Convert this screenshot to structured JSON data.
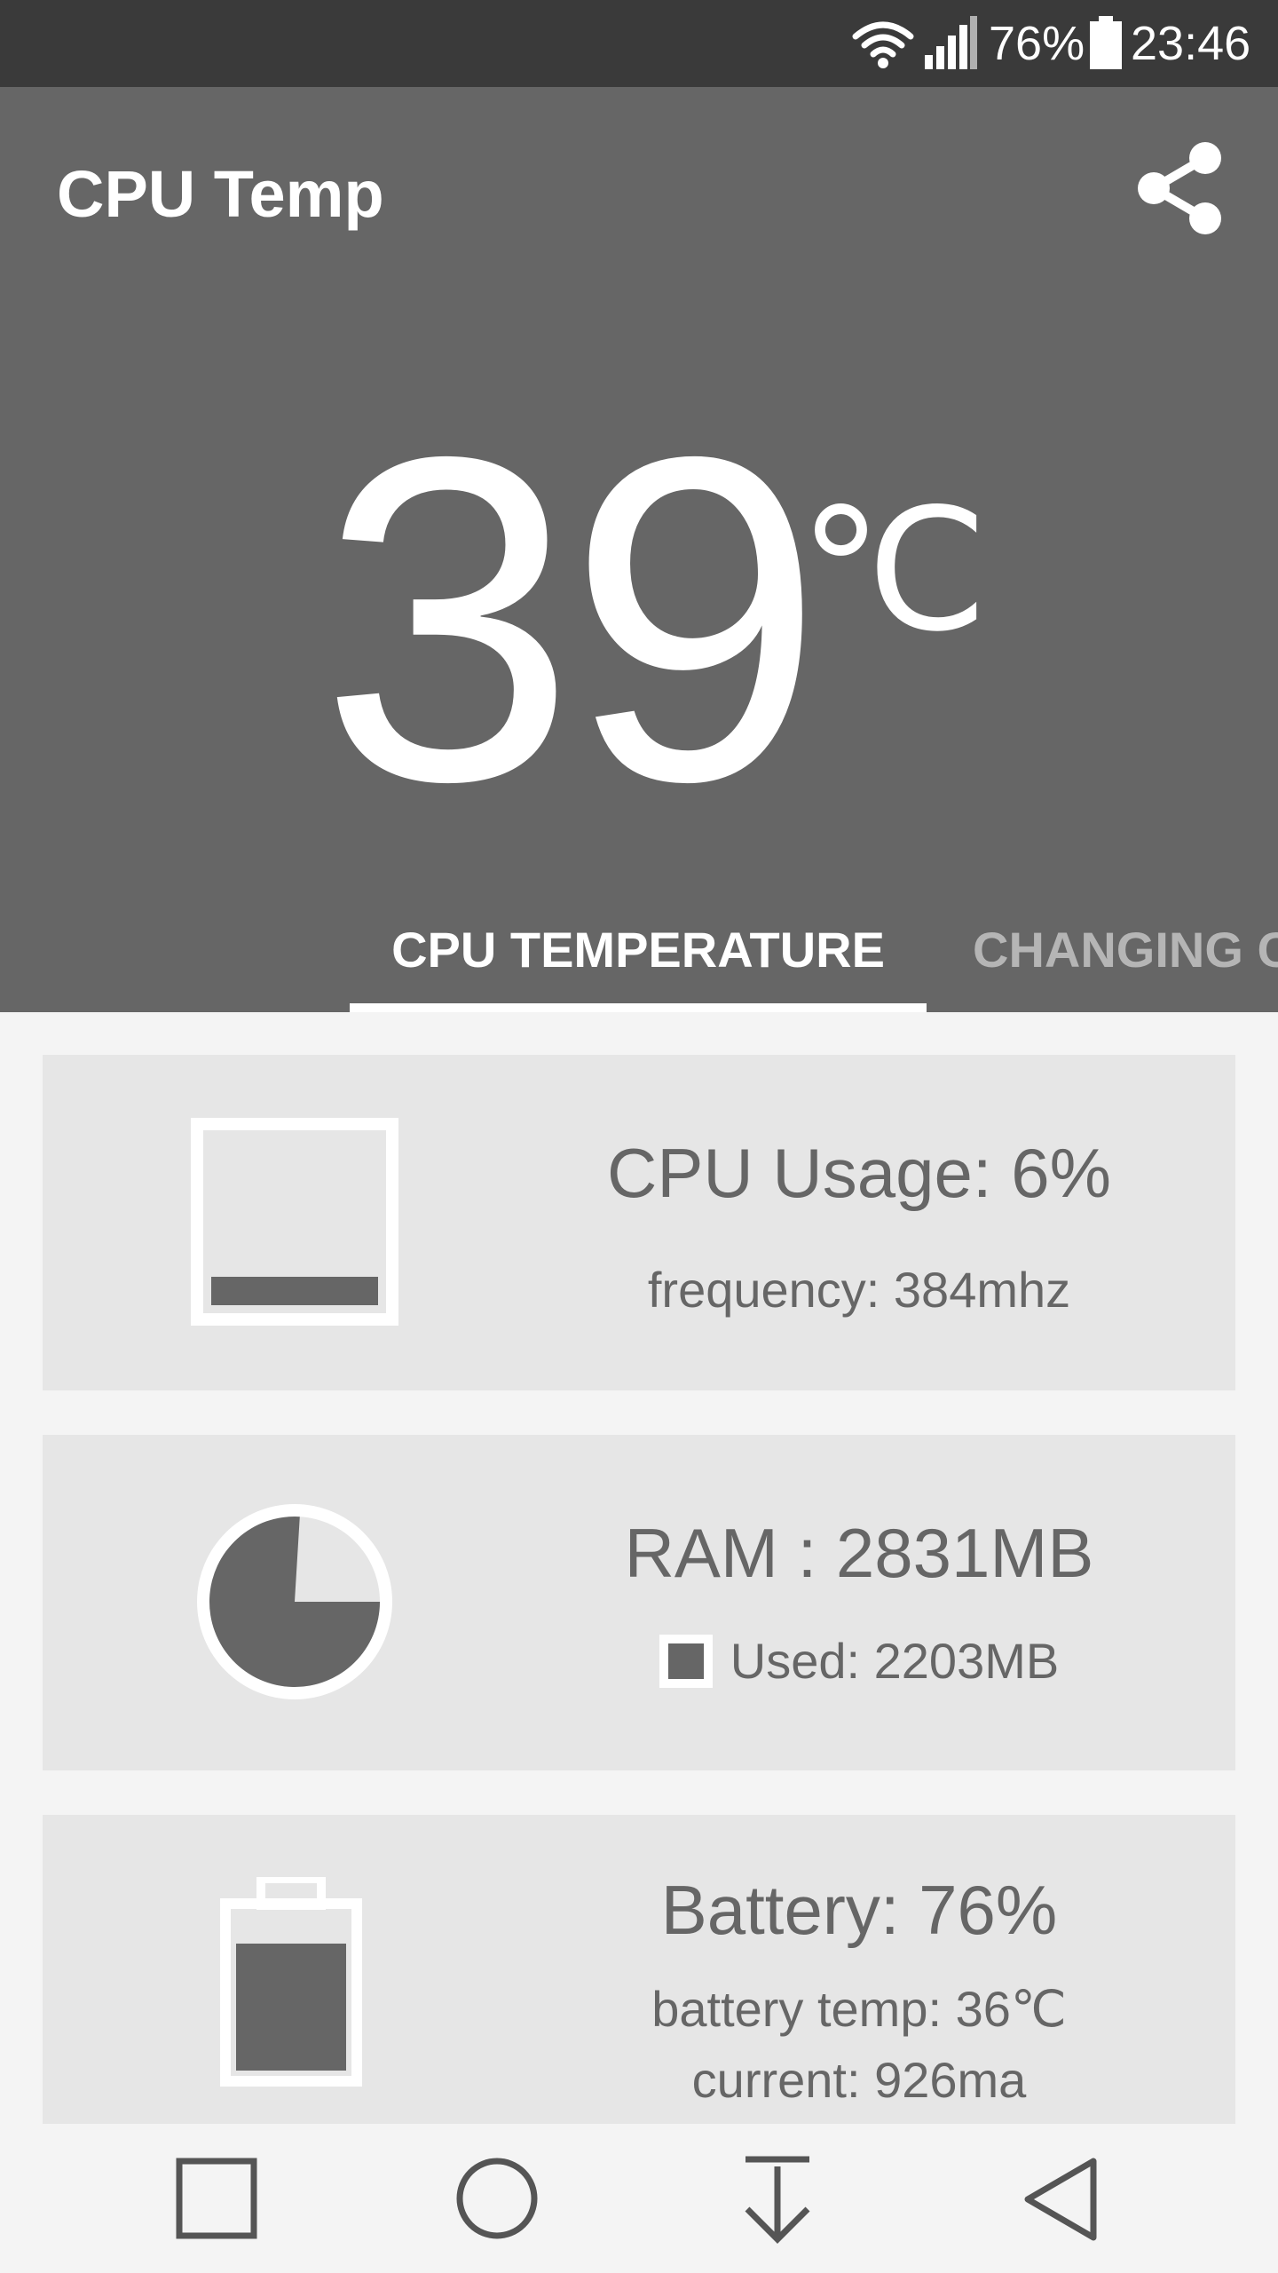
{
  "status_bar": {
    "battery_percent": "76%",
    "time": "23:46",
    "battery_level": 0.76
  },
  "app": {
    "title": "CPU Temp",
    "share_icon": "share-icon"
  },
  "temperature": {
    "value": "39",
    "unit": "℃"
  },
  "tabs": [
    {
      "label": "CPU TEMPERATURE",
      "active": true
    },
    {
      "label": "CHANGING C",
      "active": false
    }
  ],
  "cpu_card": {
    "title": "CPU Usage: 6%",
    "frequency": "frequency: 384mhz",
    "usage_fraction": 0.06
  },
  "ram_card": {
    "title": "RAM : 2831MB",
    "used": "Used: 2203MB",
    "used_fraction": 0.778
  },
  "battery_card": {
    "title": "Battery: 76%",
    "temp": "battery temp: 36℃",
    "current": "current: 926ma",
    "level_fraction": 0.76
  },
  "nav": {
    "recents": "square-icon",
    "home": "circle-icon",
    "download": "download-icon",
    "back": "back-triangle-icon"
  },
  "colors": {
    "header": "#666666",
    "status_bar": "#3a3a3a",
    "card": "#e6e6e6",
    "accent_dark": "#666666",
    "tab_inactive": "#b5b5b5"
  }
}
